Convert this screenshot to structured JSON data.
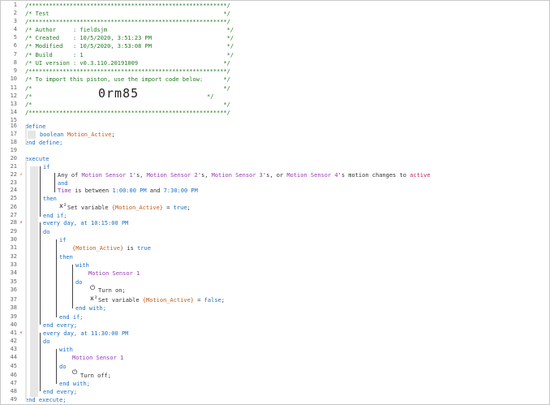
{
  "header": {
    "line1": "/**********************************************************/",
    "title": "/* Test                                                   */",
    "line3": "/**********************************************************/",
    "author": "/* Author     : fieldsjm                                   */",
    "created": "/* Created    : 10/5/2020, 3:51:23 PM                      */",
    "modified": "/* Modified   : 10/5/2020, 3:53:08 PM                      */",
    "build": "/* Build      : 1                                          */",
    "ui_version": "/* UI version : v0.3.110.20191009                         */",
    "line9": "/**********************************************************/",
    "import_note": "/* To import this piston, use the import code below:      */",
    "line11": "/*                                                        */",
    "line12_open": "/*",
    "line12_close": "*/",
    "import_code": "0rm85",
    "line13": "/*                                                        */",
    "line14": "/**********************************************************/"
  },
  "line_numbers": [
    "1",
    "2",
    "3",
    "4",
    "5",
    "6",
    "7",
    "8",
    "9",
    "10",
    "11",
    "12",
    "13",
    "14",
    "15",
    "16",
    "17",
    "18",
    "19",
    "20",
    "21",
    "22",
    "23",
    "24",
    "25",
    "26",
    "27",
    "28",
    "29",
    "30",
    "31",
    "32",
    "33",
    "34",
    "35",
    "36",
    "37",
    "38",
    "39",
    "40",
    "41",
    "42",
    "43",
    "44",
    "45",
    "46",
    "47",
    "48",
    "49"
  ],
  "code": {
    "define": "define",
    "boolean": "boolean",
    "var_decl": "Motion_Active",
    "semicolon": ";",
    "end_define": "end define;",
    "execute": "execute",
    "if": "if",
    "any_of": "Any of ",
    "ms1": "Motion Sensor 1",
    "s1": "'s, ",
    "ms2": "Motion Sensor 2",
    "s2": "'s, ",
    "ms3": "Motion Sensor 3",
    "s3": "'s, or ",
    "ms4": "Motion Sensor 4",
    "s4": "'s motion changes to ",
    "active": "active",
    "and": "and",
    "time": "Time",
    "is_between": " is between ",
    "t1": "1:00:00 PM",
    "and2": " and ",
    "t2": "7:30:00 PM",
    "then": "then",
    "set_var": "Set variable ",
    "var_ref": "{Motion_Active}",
    "eq": " = ",
    "true": "true",
    "false": "false",
    "end_if": "end if;",
    "every_day_at": "every day, at ",
    "time1": "10:15:00 PM",
    "do": "do",
    "is_true": " is ",
    "with": "with",
    "ms1_b": "Motion Sensor 1",
    "turn_on": "Turn on;",
    "end_with": "end with;",
    "end_every": "end every;",
    "time2": "11:30:00 PM",
    "turn_off": "Turn off;",
    "end_execute": "end execute;"
  },
  "icons": {
    "trigger": "lightning-icon",
    "power": "power-icon",
    "variable": "variable-icon"
  }
}
